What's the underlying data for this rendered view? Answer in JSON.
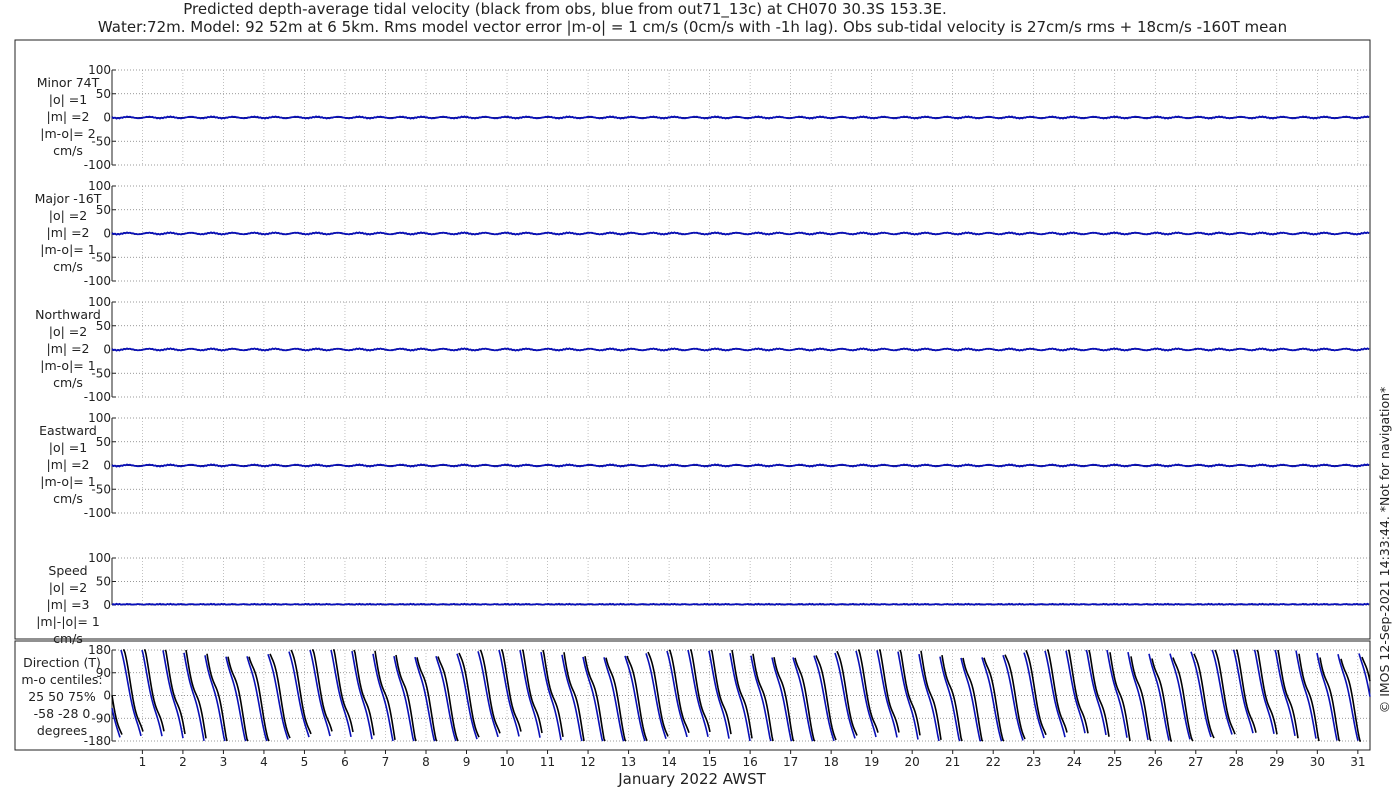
{
  "title_line1": "Predicted depth-average tidal velocity (black from obs, blue from out71_13c) at CH070 30.3S 153.3E.",
  "title_line2": "Water:72m. Model: 92 52m at 6 5km. Rms model vector error |m-o| = 1 cm/s (0cm/s with -1h lag). Obs sub-tidal velocity is 27cm/s rms + 18cm/s -160T mean",
  "copyright": "© IMOS 12-Sep-2021 14:33:44. *Not for navigation*",
  "colors": {
    "obs": "#000000",
    "model": "#0a10b8",
    "grid": "#888888"
  },
  "chart_data": {
    "type": "line",
    "xlabel": "January 2022 AWST",
    "x_ticks": [
      "1",
      "2",
      "3",
      "4",
      "5",
      "6",
      "7",
      "8",
      "9",
      "10",
      "11",
      "12",
      "13",
      "14",
      "15",
      "16",
      "17",
      "18",
      "19",
      "20",
      "21",
      "22",
      "23",
      "24",
      "25",
      "26",
      "27",
      "28",
      "29",
      "30",
      "31"
    ],
    "xlim": [
      0.25,
      31.3
    ],
    "grid": true,
    "panels": [
      {
        "label": [
          "Minor 74T",
          "|o| =1",
          "|m| =2",
          "|m-o|= 2",
          "cm/s"
        ],
        "ylim": [
          -100,
          100
        ],
        "y_ticks": [
          "100",
          "50",
          "0",
          "-50",
          "-100"
        ],
        "y_values": [
          100,
          50,
          0,
          -50,
          -100
        ],
        "obs_amplitude": 1,
        "model_amplitude": 2
      },
      {
        "label": [
          "Major -16T",
          "|o| =2",
          "|m| =2",
          "|m-o|= 1",
          "cm/s"
        ],
        "ylim": [
          -100,
          100
        ],
        "y_ticks": [
          "100",
          "50",
          "0",
          "-50",
          "-100"
        ],
        "y_values": [
          100,
          50,
          0,
          -50,
          -100
        ],
        "obs_amplitude": 2,
        "model_amplitude": 2
      },
      {
        "label": [
          "Northward",
          "|o| =2",
          "|m| =2",
          "|m-o|= 1",
          "cm/s"
        ],
        "ylim": [
          -100,
          100
        ],
        "y_ticks": [
          "100",
          "50",
          "0",
          "-50",
          "-100"
        ],
        "y_values": [
          100,
          50,
          0,
          -50,
          -100
        ],
        "obs_amplitude": 2,
        "model_amplitude": 2
      },
      {
        "label": [
          "Eastward",
          "|o| =1",
          "|m| =2",
          "|m-o|= 1",
          "cm/s"
        ],
        "ylim": [
          -100,
          100
        ],
        "y_ticks": [
          "100",
          "50",
          "0",
          "-50",
          "-100"
        ],
        "y_values": [
          100,
          50,
          0,
          -50,
          -100
        ],
        "obs_amplitude": 1,
        "model_amplitude": 2
      },
      {
        "label": [
          "Speed",
          "|o| =2",
          "|m| =3",
          "|m|-|o|= 1",
          "cm/s"
        ],
        "ylim": [
          0,
          100
        ],
        "y_ticks": [
          "100",
          "50",
          "0"
        ],
        "y_values": [
          100,
          50,
          0
        ],
        "obs_amplitude": 2,
        "model_amplitude": 3
      },
      {
        "label": [
          "Direction (T)",
          "m-o centiles:",
          "25  50  75%",
          "-58 -28   0",
          "degrees"
        ],
        "ylim": [
          -180,
          180
        ],
        "y_ticks": [
          "180",
          "90",
          "0",
          "-90",
          "-180"
        ],
        "y_values": [
          180,
          90,
          0,
          -90,
          -180
        ],
        "cycles_per_day": 1.93,
        "model_lag_cycles": 0.12
      }
    ]
  }
}
